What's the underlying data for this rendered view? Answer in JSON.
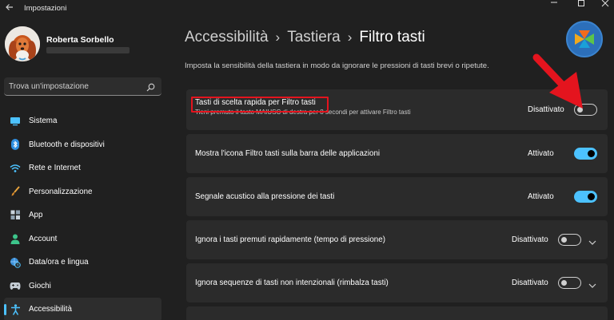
{
  "window": {
    "title": "Impostazioni"
  },
  "user": {
    "name": "Roberta Sorbello"
  },
  "search": {
    "placeholder": "Trova un'impostazione"
  },
  "sidebar": {
    "items": [
      {
        "label": "Sistema",
        "icon": "monitor-icon"
      },
      {
        "label": "Bluetooth e dispositivi",
        "icon": "bluetooth-icon"
      },
      {
        "label": "Rete e Internet",
        "icon": "wifi-icon"
      },
      {
        "label": "Personalizzazione",
        "icon": "brush-icon"
      },
      {
        "label": "App",
        "icon": "apps-icon"
      },
      {
        "label": "Account",
        "icon": "person-icon"
      },
      {
        "label": "Data/ora e lingua",
        "icon": "globe-clock-icon"
      },
      {
        "label": "Giochi",
        "icon": "gamepad-icon"
      },
      {
        "label": "Accessibilità",
        "icon": "accessibility-icon",
        "active": true
      }
    ]
  },
  "breadcrumb": {
    "level1": "Accessibilità",
    "level2": "Tastiera",
    "current": "Filtro tasti",
    "separator": "›"
  },
  "description": "Imposta la sensibilità della tastiera in modo da ignorare le pressioni di tasti brevi o ripetute.",
  "settings": [
    {
      "label": "Tasti di scelta rapida per Filtro tasti",
      "sublabel": "Tieni premuto il tasto MAIUSC di destra per 8 secondi per attivare Filtro tasti",
      "state": "Disattivato",
      "on": false
    },
    {
      "label": "Mostra l'icona Filtro tasti sulla barra delle applicazioni",
      "state": "Attivato",
      "on": true
    },
    {
      "label": "Segnale acustico alla pressione dei tasti",
      "state": "Attivato",
      "on": true
    },
    {
      "label": "Ignora i tasti premuti rapidamente (tempo di pressione)",
      "state": "Disattivato",
      "on": false,
      "expandable": true
    },
    {
      "label": "Ignora sequenze di tasti non intenzionali (rimbalza tasti)",
      "state": "Disattivato",
      "on": false,
      "expandable": true
    }
  ],
  "colors": {
    "accent": "#4cc2ff",
    "background": "#202020",
    "card": "#2b2b2b",
    "annotation_red": "#e4141e"
  }
}
